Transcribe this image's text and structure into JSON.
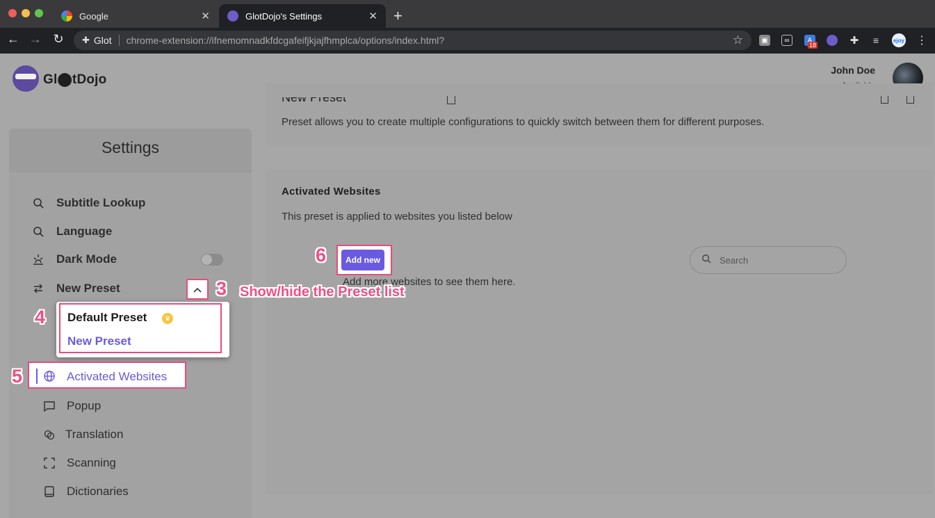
{
  "browser": {
    "tabs": [
      {
        "title": "Google",
        "icon": "google-icon",
        "active": false
      },
      {
        "title": "GlotDojo's Settings",
        "icon": "glotdojo-icon",
        "active": true
      }
    ],
    "omnibox": {
      "host": "Glot",
      "url": "chrome-extension://ifnemomnadkfdcgafeifjkjajfhmplca/options/index.html?"
    },
    "extension_badge": "18",
    "profile_label": "ejoy"
  },
  "app": {
    "logo_text": "Gl⬤tDojo",
    "user": {
      "name": "John Doe",
      "status": "Available"
    }
  },
  "sidebar": {
    "title": "Settings",
    "items": [
      {
        "label": "Subtitle Lookup",
        "icon": "search-icon"
      },
      {
        "label": "Language",
        "icon": "search-icon"
      },
      {
        "label": "Dark Mode",
        "icon": "dark-mode-icon",
        "toggle_on": false
      },
      {
        "label": "New Preset",
        "icon": "swap-arrows-icon"
      }
    ],
    "presets": [
      {
        "label": "Default Preset",
        "badge_icon": "crown-icon"
      },
      {
        "label": "New Preset",
        "selected": true
      }
    ],
    "preset_subitems": [
      {
        "label": "Activated Websites",
        "icon": "globe-icon",
        "active": true
      },
      {
        "label": "Popup",
        "icon": "chat-bubble-icon"
      },
      {
        "label": "Translation",
        "icon": "translate-icon"
      },
      {
        "label": "Scanning",
        "icon": "scan-frame-icon"
      },
      {
        "label": "Dictionaries",
        "icon": "book-icon"
      }
    ]
  },
  "main": {
    "preset_card": {
      "title": "New Preset",
      "description": "Preset allows you to create multiple configurations to quickly switch between them for different purposes."
    },
    "websites_card": {
      "title": "Activated Websites",
      "description": "This preset is applied to websites you listed below",
      "add_button": "Add new",
      "empty_text": "Add more websites to see them here.",
      "search_placeholder": "Search"
    }
  },
  "annotations": [
    {
      "number": "3",
      "text": "Show/hide the Preset list"
    },
    {
      "number": "4",
      "text": ""
    },
    {
      "number": "5",
      "text": ""
    },
    {
      "number": "6",
      "text": ""
    }
  ]
}
